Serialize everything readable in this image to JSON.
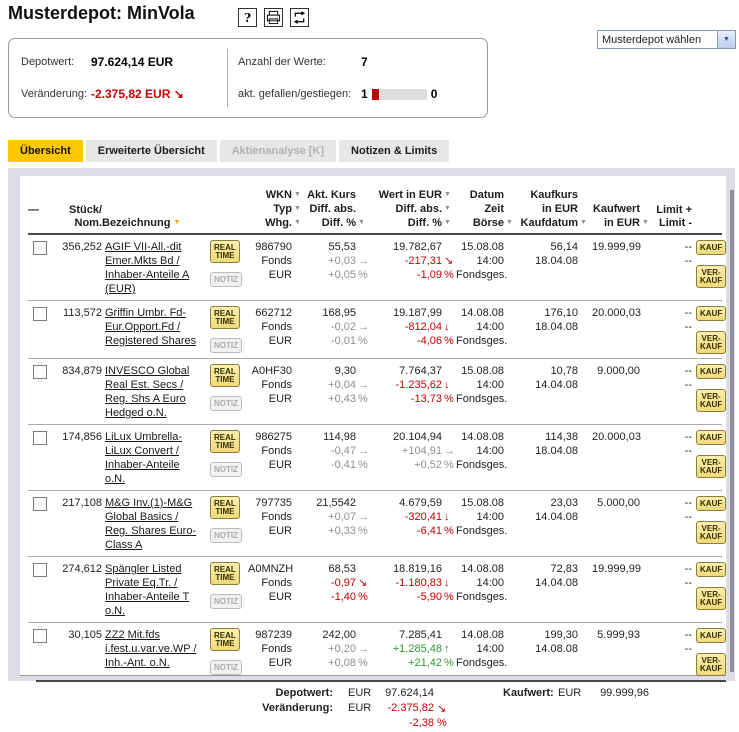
{
  "page": {
    "title": "Musterdepot: MinVola"
  },
  "title_icons": {
    "help": "?",
    "print": "printer",
    "refresh": "refresh"
  },
  "depot_select": {
    "label": "Musterdepot wählen",
    "arrow": "▼"
  },
  "summary": {
    "depotwert_label": "Depotwert:",
    "depotwert_value": "97.624,14 EUR",
    "veraenderung_label": "Veränderung:",
    "veraenderung_value": "-2.375,82 EUR",
    "anzahl_label": "Anzahl der Werte:",
    "anzahl_value": "7",
    "fallen_label": "akt. gefallen/gestiegen:",
    "fallen_count": "1",
    "gestiegen_count": "0"
  },
  "tabs": [
    {
      "label": "Übersicht",
      "state": "active"
    },
    {
      "label": "Erweiterte Übersicht",
      "state": "normal"
    },
    {
      "label": "Aktienanalyse [K]",
      "state": "disabled"
    },
    {
      "label": "Notizen & Limits",
      "state": "normal"
    }
  ],
  "buttons": {
    "realtime": [
      "REAL",
      "TIME"
    ],
    "notiz": "NOTIZ",
    "kauf": "KAUF",
    "verkauf": [
      "VER-",
      "KAUF"
    ]
  },
  "glyphs": {
    "right": "→",
    "down": "↓",
    "downright": "↘",
    "up": "↑",
    "sort": "▼",
    "dash": "—",
    "percent": "%"
  },
  "colors": {
    "accent_yellow": "#FFC800",
    "negative": "#C80000",
    "positive": "#2E9932",
    "neutral": "#8F8F8F",
    "button_yellow": "#F1D979"
  },
  "table": {
    "columns": [
      {
        "id": "select",
        "align": "l",
        "lines": [
          {
            "t": "—"
          },
          {
            "t": ""
          }
        ]
      },
      {
        "id": "stueck",
        "align": "r",
        "lines": [
          {
            "t": "Stück/"
          },
          {
            "t": "Nom."
          }
        ]
      },
      {
        "id": "bezeichnung",
        "align": "l",
        "lines": [
          {
            "t": "Bezeichnung",
            "sort": "orange"
          }
        ]
      },
      {
        "id": "info",
        "align": "l",
        "lines": []
      },
      {
        "id": "wkn",
        "align": "r",
        "gutter": true,
        "lines": [
          {
            "t": "WKN",
            "sort": "gray"
          },
          {
            "t": "Typ",
            "sort": "gray"
          },
          {
            "t": "Whg.",
            "sort": "gray"
          }
        ]
      },
      {
        "id": "kurs",
        "align": "r",
        "gutter": true,
        "lines": [
          {
            "t": "Akt. Kurs"
          },
          {
            "t": "Diff. abs."
          },
          {
            "t": "Diff. %",
            "sort": "gray"
          }
        ]
      },
      {
        "id": "wert",
        "align": "r",
        "gutter": true,
        "lines": [
          {
            "t": "Wert in EUR",
            "sort": "gray"
          },
          {
            "t": "Diff. abs.",
            "sort": "gray"
          },
          {
            "t": "Diff. %",
            "sort": "gray"
          }
        ]
      },
      {
        "id": "datum",
        "align": "r",
        "gutter": true,
        "lines": [
          {
            "t": "Datum"
          },
          {
            "t": "Zeit"
          },
          {
            "t": "Börse",
            "sort": "gray"
          }
        ]
      },
      {
        "id": "kaufkurs",
        "align": "r",
        "gutter": true,
        "lines": [
          {
            "t": "Kaufkurs"
          },
          {
            "t": "in EUR"
          },
          {
            "t": "Kaufdatum",
            "sort": "gray"
          }
        ]
      },
      {
        "id": "kaufwert",
        "align": "r",
        "gutter": true,
        "lines": [
          {
            "t": "Kaufwert"
          },
          {
            "t": "in EUR",
            "sort": "gray"
          }
        ]
      },
      {
        "id": "limit",
        "align": "r",
        "lines": [
          {
            "t": "Limit +"
          },
          {
            "t": "Limit -"
          }
        ]
      },
      {
        "id": "trade",
        "align": "l",
        "lines": []
      }
    ],
    "rows": [
      {
        "stueck": "356,252",
        "name": "AGIF VII-All.-dit Emer.Mkts Bd / Inhaber-Anteile A (EUR)",
        "wkn": "986790",
        "typ": "Fonds",
        "whg": "EUR",
        "kurs": "55,53",
        "kurs_diff": "+0,03",
        "kurs_arrow": "right",
        "kurs_pct": "+0,05 %",
        "kurs_trend": "neutral",
        "wert": "19.782,67",
        "wert_diff": "-217,31",
        "wert_arrow": "downright",
        "wert_pct": "-1,09 %",
        "wert_trend": "neg",
        "datum": "15.08.08",
        "zeit": "14:00",
        "boerse": "Fondsges.",
        "kaufkurs": "56,14",
        "kaufdatum": "18.04.08",
        "kaufwert": "19.999,99",
        "limit_plus": "--",
        "limit_minus": "--"
      },
      {
        "stueck": "113,572",
        "name": "Griffin Umbr. Fd-Eur.Opport.Fd / Registered Shares",
        "wkn": "662712",
        "typ": "Fonds",
        "whg": "EUR",
        "kurs": "168,95",
        "kurs_diff": "-0,02",
        "kurs_arrow": "right",
        "kurs_pct": "-0,01 %",
        "kurs_trend": "neutral",
        "wert": "19.187,99",
        "wert_diff": "-812,04",
        "wert_arrow": "down",
        "wert_pct": "-4,06 %",
        "wert_trend": "neg",
        "datum": "14.08.08",
        "zeit": "14:00",
        "boerse": "Fondsges.",
        "kaufkurs": "176,10",
        "kaufdatum": "18.04.08",
        "kaufwert": "20.000,03",
        "limit_plus": "--",
        "limit_minus": "--"
      },
      {
        "stueck": "834,879",
        "name": "INVESCO Global Real Est. Secs / Reg. Shs A Euro Hedged o.N.",
        "wkn": "A0HF30",
        "typ": "Fonds",
        "whg": "EUR",
        "kurs": "9,30",
        "kurs_diff": "+0,04",
        "kurs_arrow": "right",
        "kurs_pct": "+0,43 %",
        "kurs_trend": "neutral",
        "wert": "7.764,37",
        "wert_diff": "-1.235,62",
        "wert_arrow": "down",
        "wert_pct": "-13,73 %",
        "wert_trend": "neg",
        "datum": "15.08.08",
        "zeit": "14:00",
        "boerse": "Fondsges.",
        "kaufkurs": "10,78",
        "kaufdatum": "14.04.08",
        "kaufwert": "9.000,00",
        "limit_plus": "--",
        "limit_minus": "--"
      },
      {
        "stueck": "174,856",
        "name": "LiLux Umbrella-LiLux Convert / Inhaber-Anteile o.N.",
        "wkn": "986275",
        "typ": "Fonds",
        "whg": "EUR",
        "kurs": "114,98",
        "kurs_diff": "-0,47",
        "kurs_arrow": "right",
        "kurs_pct": "-0,41 %",
        "kurs_trend": "neutral",
        "wert": "20.104,94",
        "wert_diff": "+104,91",
        "wert_arrow": "right",
        "wert_pct": "+0,52 %",
        "wert_trend": "neutral",
        "datum": "14.08.08",
        "zeit": "14:00",
        "boerse": "Fondsges.",
        "kaufkurs": "114,38",
        "kaufdatum": "18.04.08",
        "kaufwert": "20.000,03",
        "limit_plus": "--",
        "limit_minus": "--"
      },
      {
        "stueck": "217,108",
        "name": "M&G Inv.(1)-M&G Global Basics / Reg. Shares Euro-Class A",
        "wkn": "797735",
        "typ": "Fonds",
        "whg": "EUR",
        "kurs": "21,5542",
        "kurs_diff": "+0,07",
        "kurs_arrow": "right",
        "kurs_pct": "+0,33 %",
        "kurs_trend": "neutral",
        "wert": "4.679,59",
        "wert_diff": "-320,41",
        "wert_arrow": "down",
        "wert_pct": "-6,41 %",
        "wert_trend": "neg",
        "datum": "15.08.08",
        "zeit": "14:00",
        "boerse": "Fondsges.",
        "kaufkurs": "23,03",
        "kaufdatum": "14.04.08",
        "kaufwert": "5.000,00",
        "limit_plus": "--",
        "limit_minus": "--"
      },
      {
        "stueck": "274,612",
        "name": "Spängler Listed Private Eq.Tr. / Inhaber-Anteile T o.N.",
        "wkn": "A0MNZH",
        "typ": "Fonds",
        "whg": "EUR",
        "kurs": "68,53",
        "kurs_diff": "-0,97",
        "kurs_arrow": "downright",
        "kurs_pct": "-1,40 %",
        "kurs_trend": "neg",
        "wert": "18.819,16",
        "wert_diff": "-1.180,83",
        "wert_arrow": "down",
        "wert_pct": "-5,90 %",
        "wert_trend": "neg",
        "datum": "14.08.08",
        "zeit": "14:00",
        "boerse": "Fondsges.",
        "kaufkurs": "72,83",
        "kaufdatum": "14.04.08",
        "kaufwert": "19.999,99",
        "limit_plus": "--",
        "limit_minus": "--"
      },
      {
        "stueck": "30,105",
        "name": "ZZ2 Mit.fds i.fest.u.var.ve.WP / Inh.-Ant. o.N.",
        "wkn": "987239",
        "typ": "Fonds",
        "whg": "EUR",
        "kurs": "242,00",
        "kurs_diff": "+0,20",
        "kurs_arrow": "right",
        "kurs_pct": "+0,08 %",
        "kurs_trend": "neutral",
        "wert": "7.285,41",
        "wert_diff": "+1.285,48",
        "wert_arrow": "up",
        "wert_pct": "+21,42 %",
        "wert_trend": "pos",
        "datum": "14.08.08",
        "zeit": "14:00",
        "boerse": "Fondsges.",
        "kaufkurs": "199,30",
        "kaufdatum": "14.08.08",
        "kaufwert": "5.999,93",
        "limit_plus": "--",
        "limit_minus": "--"
      }
    ]
  },
  "totals": {
    "depotwert_label": "Depotwert:",
    "currency": "EUR",
    "depotwert_value": "97.624,14",
    "veraenderung_label": "Veränderung:",
    "veraenderung_value": "-2.375,82",
    "veraenderung_pct": "-2,38",
    "kaufwert_label": "Kaufwert:",
    "kaufwert_value": "99.999,96"
  }
}
